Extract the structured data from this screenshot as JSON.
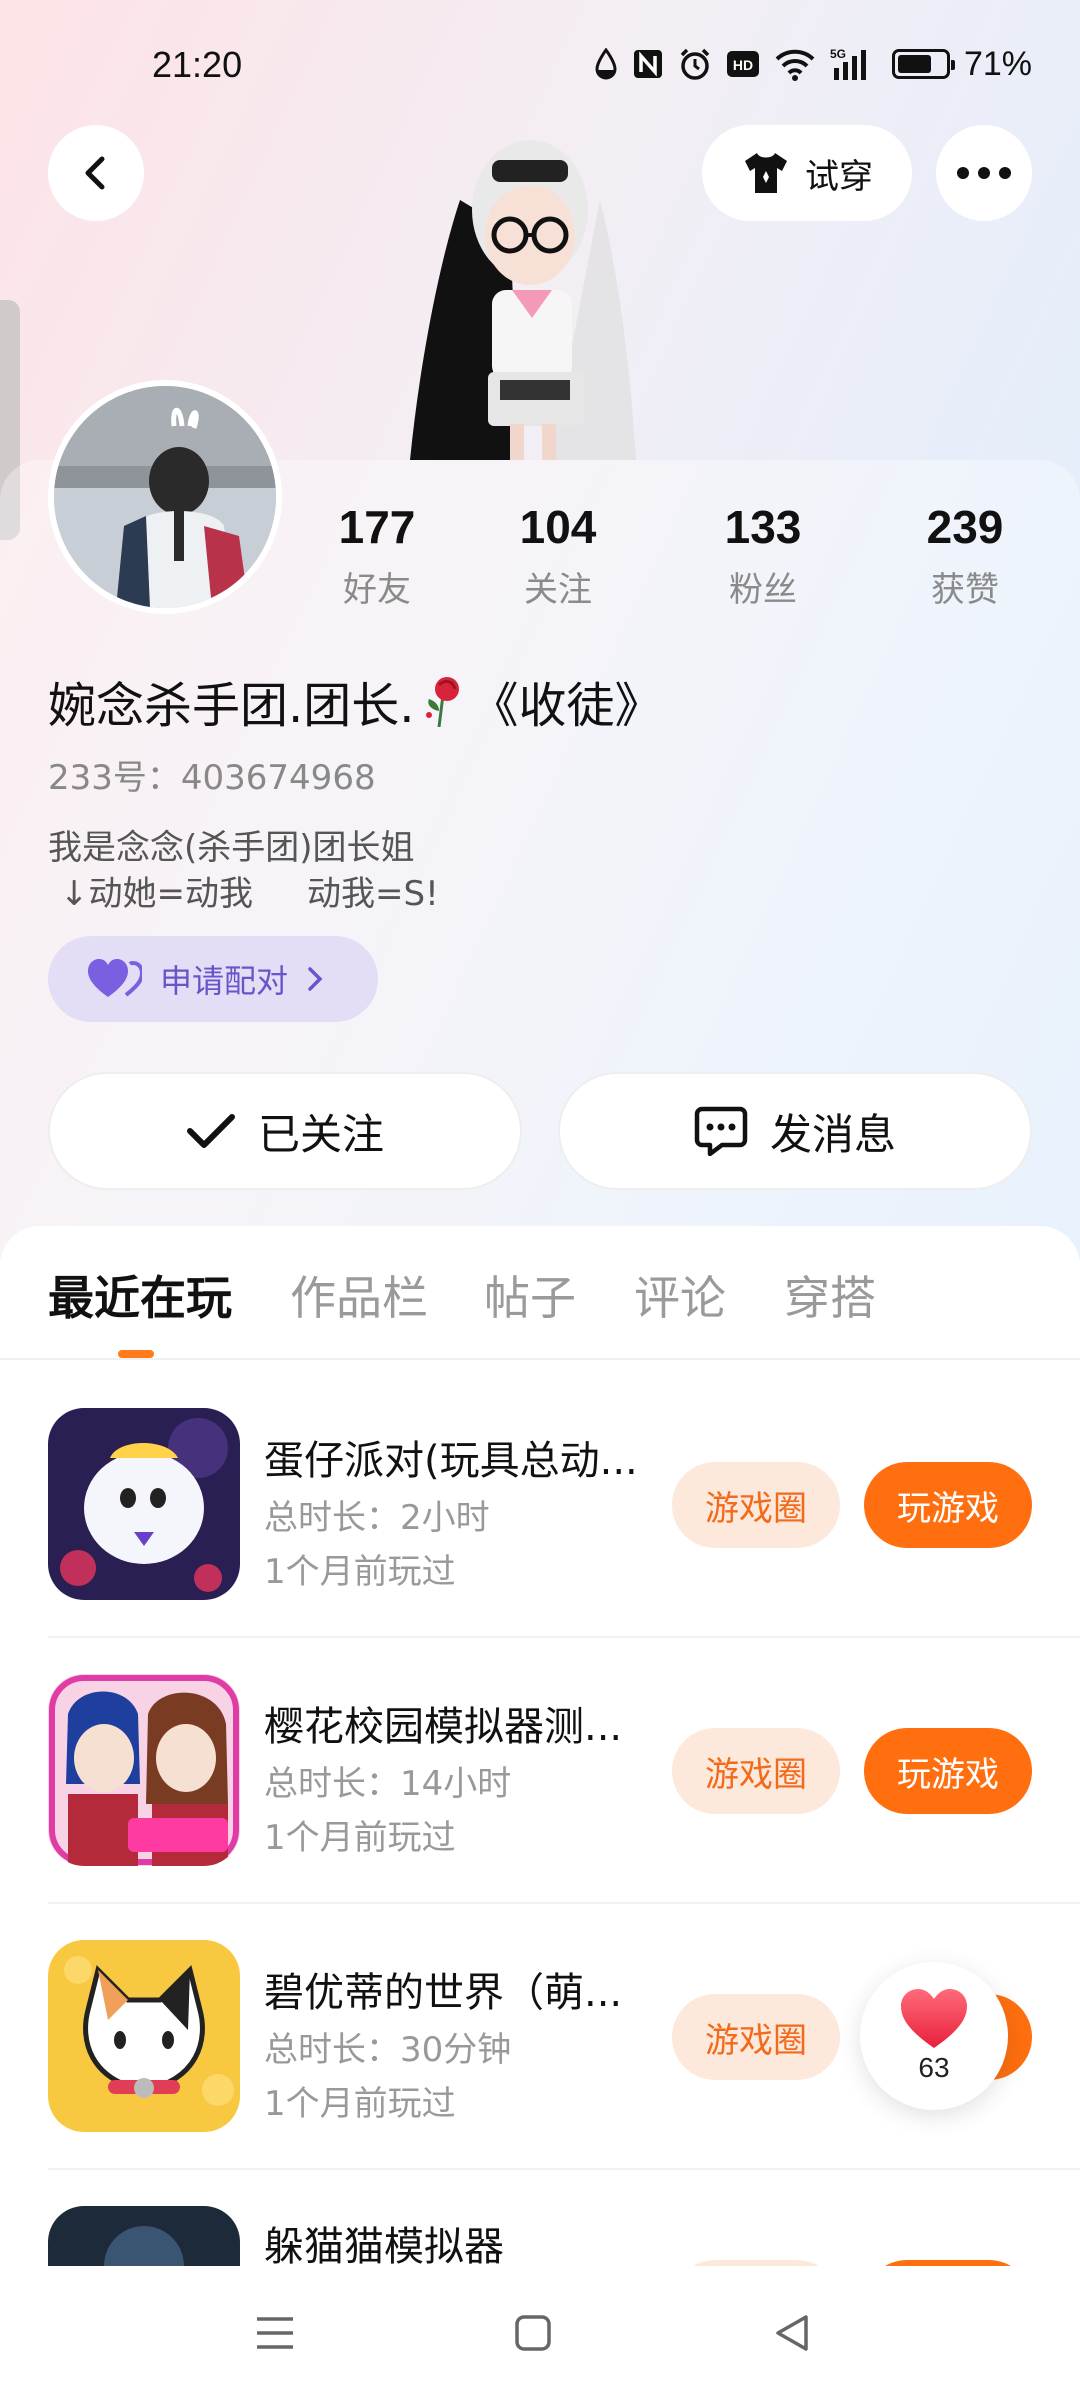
{
  "status_bar": {
    "time": "21:20",
    "battery_pct": "71%",
    "icons": [
      "water-drop-icon",
      "nfc-icon",
      "alarm-icon",
      "hd-icon",
      "wifi-icon",
      "5g-signal-icon",
      "battery-icon"
    ]
  },
  "header": {
    "tryon_label": "试穿"
  },
  "profile": {
    "name": "婉念杀手团.团长.",
    "name_suffix": "《收徒》",
    "uid": "233号：403674968",
    "bio_line1": "我是念念(杀手团)团长姐",
    "bio_line2": "↓动她=动我     动我=S!",
    "pair_label": "申请配对",
    "stats": [
      {
        "num": "177",
        "label": "好友"
      },
      {
        "num": "104",
        "label": "关注"
      },
      {
        "num": "133",
        "label": "粉丝"
      },
      {
        "num": "239",
        "label": "获赞"
      }
    ],
    "follow_label": "已关注",
    "message_label": "发消息"
  },
  "tabs": [
    "最近在玩",
    "作品栏",
    "帖子",
    "评论",
    "穿搭"
  ],
  "games": [
    {
      "title": "蛋仔派对(玩具总动...",
      "duration": "总时长：2小时",
      "last": "1个月前玩过",
      "circle": "游戏圈",
      "play": "玩游戏"
    },
    {
      "title": "樱花校园模拟器测...",
      "duration": "总时长：14小时",
      "last": "1个月前玩过",
      "circle": "游戏圈",
      "play": "玩游戏"
    },
    {
      "title": "碧优蒂的世界（萌...",
      "duration": "总时长：30分钟",
      "last": "1个月前玩过",
      "circle": "游戏圈",
      "play": "玩游戏"
    },
    {
      "title": "躲猫猫模拟器"
    }
  ],
  "like_float": {
    "count": "63"
  },
  "colors": {
    "accent": "#ff6f10",
    "accent_soft": "#fde8dc",
    "pair_bg": "#e4ddf6",
    "pair_fg": "#6a55c8"
  }
}
